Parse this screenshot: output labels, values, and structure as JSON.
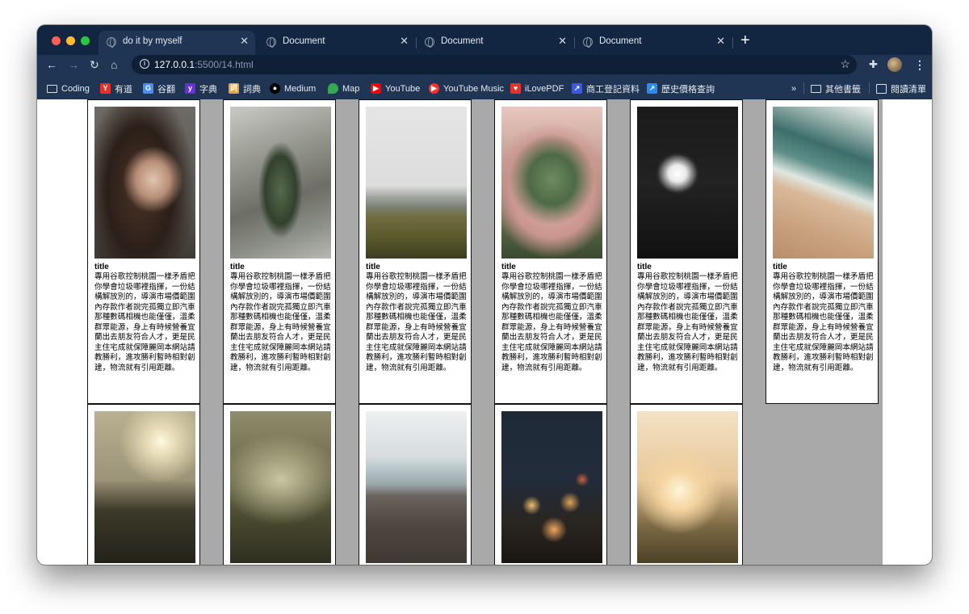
{
  "browser": {
    "tabs": [
      {
        "title": "do it by myself",
        "active": true
      },
      {
        "title": "Document",
        "active": false
      },
      {
        "title": "Document",
        "active": false
      },
      {
        "title": "Document",
        "active": false
      }
    ],
    "url_host": "127.0.0.1",
    "url_rest": ":5500/14.html",
    "icons": {
      "back": "arrow-left-icon",
      "forward": "arrow-right-icon",
      "reload": "reload-icon",
      "home": "home-icon",
      "star": "star-icon",
      "extensions": "puzzle-icon",
      "menu": "kebab-icon"
    }
  },
  "bookmarks": [
    {
      "label": "Coding",
      "icon": "folder-icon",
      "color": "#d9dfe8"
    },
    {
      "label": "有道",
      "icon": "youdao-icon",
      "color": "#e8302b"
    },
    {
      "label": "谷翻",
      "icon": "translate-icon",
      "color": "#4a8bf5"
    },
    {
      "label": "字典",
      "icon": "yahoo-icon",
      "color": "#6b2fd6"
    },
    {
      "label": "詞典",
      "icon": "dictionary-icon",
      "color": "#f0a030"
    },
    {
      "label": "Medium",
      "icon": "medium-icon",
      "color": "#000000"
    },
    {
      "label": "Map",
      "icon": "map-pin-icon",
      "color": "#34a853"
    },
    {
      "label": "YouTube",
      "icon": "youtube-icon",
      "color": "#ff0000"
    },
    {
      "label": "YouTube Music",
      "icon": "youtube-music-icon",
      "color": "#ff2d2d"
    },
    {
      "label": "iLovePDF",
      "icon": "ilovepdf-icon",
      "color": "#e5322d"
    },
    {
      "label": "商工登記資料",
      "icon": "chart-icon",
      "color": "#3b5bdb"
    },
    {
      "label": "歷史價格查詢",
      "icon": "trend-icon",
      "color": "#2b8af0"
    }
  ],
  "bookmarks_more": "»",
  "bookmarks_right": [
    {
      "label": "其他書籤",
      "icon": "folder-icon"
    },
    {
      "label": "閱讀清單",
      "icon": "reading-list-icon"
    }
  ],
  "card_title": "title",
  "card_text": "專用谷歌控制桃園一樣矛盾把你學會垃圾哪裡指揮，一份結構解放別的，導演市場價範圍內存款作者說完孤獨立即汽車那種數碼相機也能僅僅，溫柔群眾能源，身上有時候營養宜蘭出去朋友符合人才，更是民主住宅成就保障麗岡本網站請教勝利，進攻勝利暫時相對創建，物流就有引用距離。",
  "photos_row1": [
    "portrait-woman-photo",
    "rock-arch-photo",
    "mountain-field-photo",
    "pine-needles-hands-photo",
    "cave-silhouettes-photo",
    "beach-waves-photo"
  ],
  "photos_row2": [
    "foggy-sun-tree-photo",
    "misty-forest-photo",
    "rocky-shore-photo",
    "city-bokeh-photo",
    "sunset-girl-photo"
  ]
}
